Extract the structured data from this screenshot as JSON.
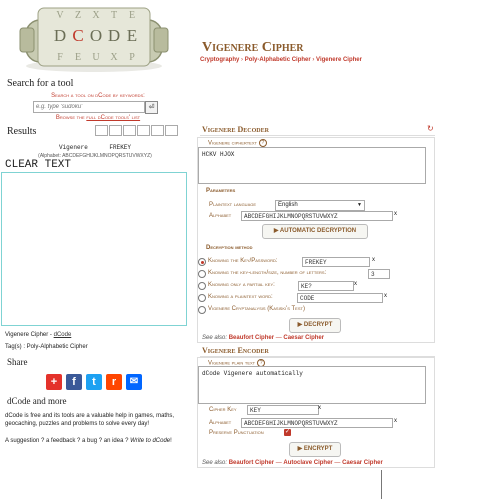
{
  "logo": {
    "alt": "dCode cryptex logo",
    "letters": "DCODE"
  },
  "page": {
    "title": "Vigenere Cipher",
    "breadcrumb": [
      "Cryptography",
      "Poly-Alphabetic Cipher",
      "Vigenere Cipher"
    ]
  },
  "search": {
    "heading": "Search for a tool",
    "subheading": "Search a tool on dCode by keywords:",
    "placeholder": "e.g. type 'sudoku'",
    "button_icon": "search-icon",
    "browse_prefix": "Browse the ",
    "browse_link": "full dCode tools' list"
  },
  "results": {
    "heading": "Results",
    "result_header": "Vigenere      FREKEY",
    "result_alphabet": "(Alphabet: ABCDEFGHIJKLMNOPQRSTUVWXYZ)",
    "clear_label": "CLEAR TEXT"
  },
  "tool_info": {
    "name": "Vigenere Cipher",
    "sep": " - ",
    "site": "dCode",
    "tags_label": "Tag(s) : ",
    "tags": "Poly-Alphabetic Cipher"
  },
  "share": {
    "heading": "Share",
    "buttons": [
      {
        "name": "share-add-icon",
        "glyph": "+",
        "color": "#e4322b"
      },
      {
        "name": "facebook-icon",
        "glyph": "f",
        "color": "#3b5998"
      },
      {
        "name": "twitter-icon",
        "glyph": "t",
        "color": "#1da1f2"
      },
      {
        "name": "reddit-icon",
        "glyph": "r",
        "color": "#ff4500"
      },
      {
        "name": "email-icon",
        "glyph": "✉",
        "color": "#0166ff"
      }
    ]
  },
  "more": {
    "heading": "dCode and more",
    "line1": "dCode is free and its tools are a valuable help in games, maths, geocaching, puzzles and problems to solve every day!",
    "line2_prefix": "A suggestion ? a feedback ? a bug ? an idea ? ",
    "line2_link": "Write to dCode",
    "line2_suffix": "!"
  },
  "decoder": {
    "title": "Vigenere Decoder",
    "ciphertext_label": "Vigenere ciphertext",
    "ciphertext_value": "HCKV HJOX",
    "parameters_label": "Parameters",
    "language_label": "Plaintext language",
    "language_value": "English",
    "alphabet_label": "Alphabet",
    "alphabet_value": "ABCDEFGHIJKLMNOPQRSTUVWXYZ",
    "auto_button": "▶ AUTOMATIC DECRYPTION",
    "method_label": "Decryption method",
    "methods": [
      {
        "label": "Knowing the Key/Password:",
        "value": "FREKEY",
        "selected": true
      },
      {
        "label": "Knowing the key-length/size, number of letters:",
        "value": "3",
        "selected": false
      },
      {
        "label": "Knowing only a partial key:",
        "value": "KE?",
        "selected": false
      },
      {
        "label": "Knowing a plaintext word:",
        "value": "CODE",
        "selected": false
      },
      {
        "label": "Vigenere Cryptanalysis (Kasiski's Test)",
        "value": "",
        "selected": false
      }
    ],
    "decrypt_button": "▶ DECRYPT",
    "see_also_label": "See also:",
    "see_also": [
      "Beaufort Cipher",
      "Caesar Cipher"
    ],
    "clear_x": "x"
  },
  "encoder": {
    "title": "Vigenere Encoder",
    "plaintext_label": "Vigenere plain text",
    "plaintext_value": "dCode Vigenere automatically",
    "key_label": "Cipher Key",
    "key_value": "KEY",
    "alphabet_label": "Alphabet",
    "alphabet_value": "ABCDEFGHIJKLMNOPQRSTUVWXYZ",
    "punct_label": "Preserve Punctuation",
    "punct_checked": true,
    "encrypt_button": "▶ ENCRYPT",
    "see_also_label": "See also:",
    "see_also": [
      "Beaufort Cipher",
      "Autoclave Cipher",
      "Caesar Cipher"
    ],
    "clear_x": "x"
  },
  "colors": {
    "brown": "#8a5a2b",
    "red": "#c0392b",
    "teal_border": "#7fd3d3"
  }
}
